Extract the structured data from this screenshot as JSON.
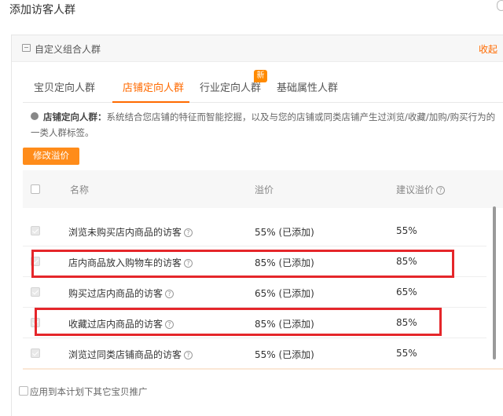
{
  "dialog": {
    "title": "添加访客人群"
  },
  "panel": {
    "title": "自定义组合人群",
    "collapse_label": "收起"
  },
  "tabs": [
    {
      "label": "宝贝定向人群",
      "active": false
    },
    {
      "label": "店铺定向人群",
      "active": true
    },
    {
      "label": "行业定向人群",
      "active": false,
      "badge": "新"
    },
    {
      "label": "基础属性人群",
      "active": false
    }
  ],
  "info": {
    "title": "店铺定向人群：",
    "text": "系统结合您店铺的特征而智能挖掘，以及与您的店铺或同类店铺产生过浏览/收藏/加购/购买行为的一类人群标签。"
  },
  "modify_button": "修改溢价",
  "table": {
    "headers": {
      "name": "名称",
      "premium": "溢价",
      "suggested": "建议溢价"
    },
    "rows": [
      {
        "name": "浏览未购买店内商品的访客",
        "premium": "55% (已添加)",
        "suggested": "55%"
      },
      {
        "name": "店内商品放入购物车的访客",
        "premium": "85% (已添加)",
        "suggested": "85%"
      },
      {
        "name": "购买过店内商品的访客",
        "premium": "65% (已添加)",
        "suggested": "65%"
      },
      {
        "name": "收藏过店内商品的访客",
        "premium": "85% (已添加)",
        "suggested": "85%"
      },
      {
        "name": "浏览过同类店铺商品的访客",
        "premium": "55% (已添加)",
        "suggested": "55%"
      }
    ]
  },
  "footer": {
    "apply_label": "应用到本计划下其它宝贝推广"
  },
  "colors": {
    "accent": "#ff6a00",
    "highlight": "#e5262a"
  },
  "icons": {
    "help": "?"
  }
}
